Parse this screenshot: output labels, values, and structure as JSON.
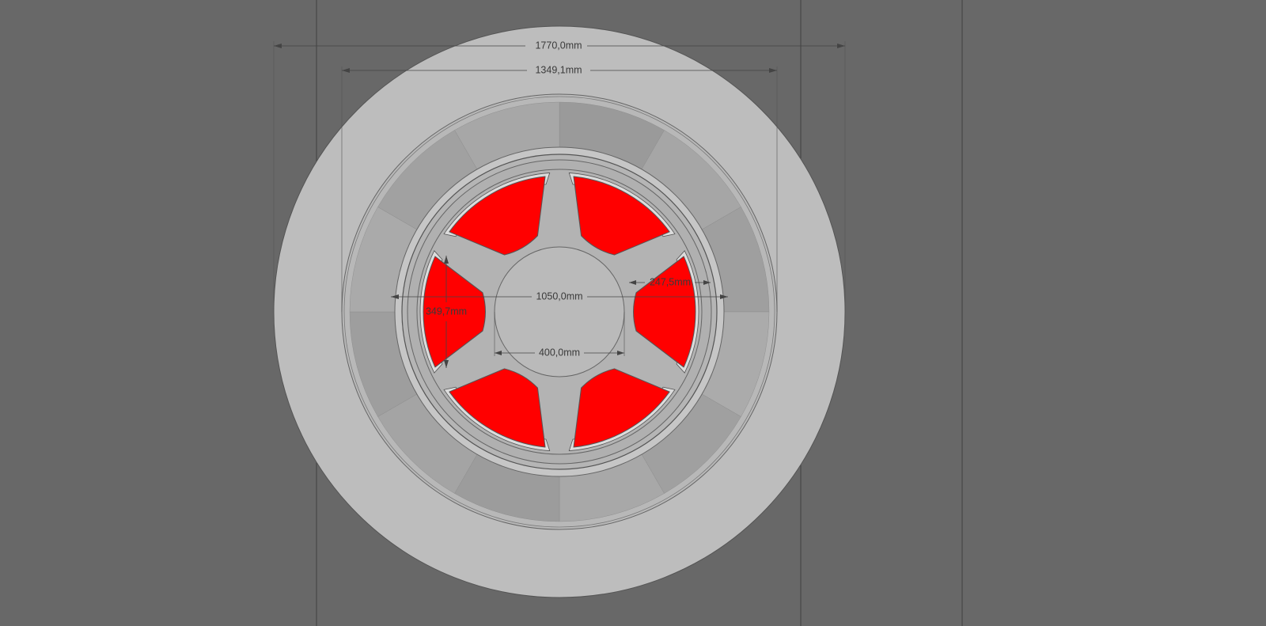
{
  "dimensions": {
    "overall_diameter": "1770,0mm",
    "rim_diameter": "1349,1mm",
    "hub_ring_diameter": "1050,0mm",
    "hub_diameter": "400,0mm",
    "window_height": "349,7mm",
    "window_width": "247,5mm"
  },
  "colors": {
    "background": "#686868",
    "tire": "#bdbdbd",
    "rim_band": "#9e9e9e",
    "hub_disc": "#b3b3b3",
    "windows": "#ff0000"
  },
  "window_count": 6
}
